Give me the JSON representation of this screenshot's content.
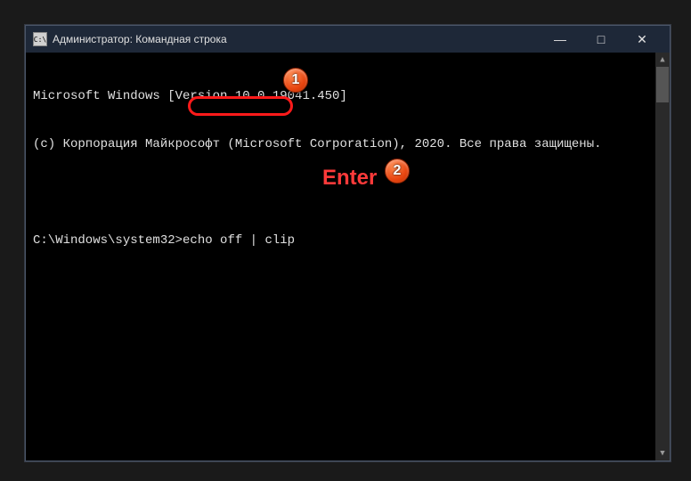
{
  "window": {
    "title": "Администратор: Командная строка",
    "controls": {
      "minimize": "—",
      "maximize": "□",
      "close": "✕"
    }
  },
  "terminal": {
    "line1": "Microsoft Windows [Version 10.0.19041.450]",
    "line2": "(c) Корпорация Майкрософт (Microsoft Corporation), 2020. Все права защищены.",
    "prompt": "C:\\Windows\\system32>",
    "command": "echo off | clip"
  },
  "annotations": {
    "badge1": "1",
    "badge2": "2",
    "label2": "Enter"
  }
}
